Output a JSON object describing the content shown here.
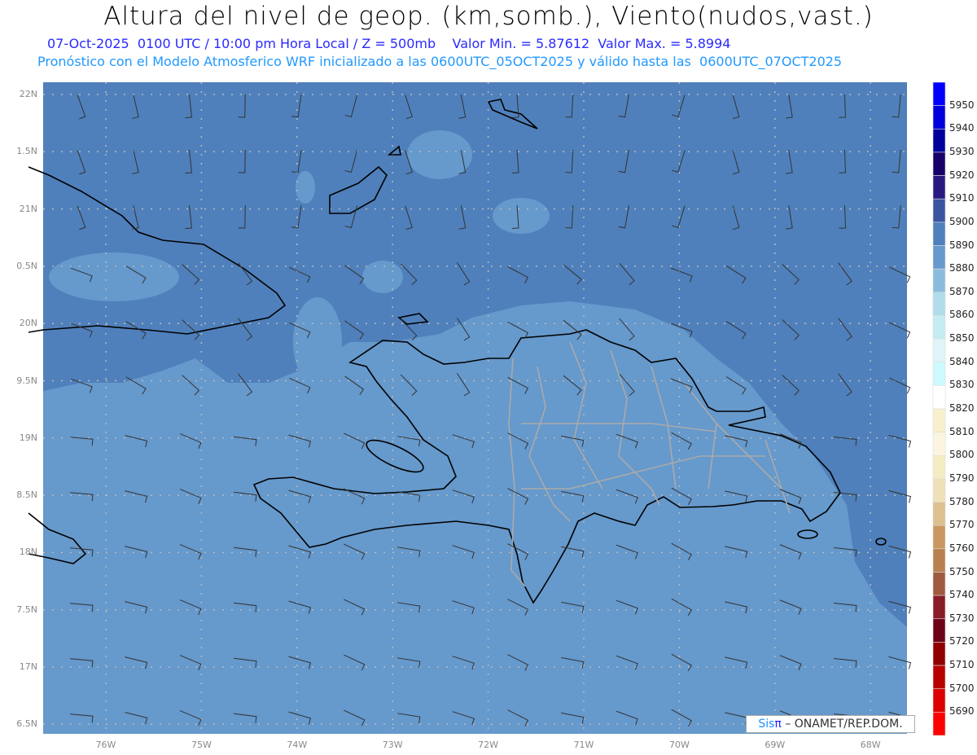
{
  "title": "Altura del nivel de geop. (km,somb.), Viento(nudos,vast.)",
  "subtitle1": "07-Oct-2025  0100 UTC / 10:00 pm Hora Local / Z = 500mb    Valor Min. = 5.87612  Valor Max. = 5.8994",
  "subtitle2": "Pronóstico con el Modelo Atmosferico WRF inicializado a las 0600UTC_05OCT2025 y válido hasta las  0600UTC_07OCT2025",
  "lat_labels": [
    "22N",
    "1.5N",
    "21N",
    "0.5N",
    "20N",
    "9.5N",
    "19N",
    "8.5N",
    "18N",
    "7.5N",
    "17N",
    "6.5N"
  ],
  "lon_labels": [
    "76W",
    "75W",
    "74W",
    "73W",
    "72W",
    "71W",
    "70W",
    "69W",
    "68W"
  ],
  "colorbar": {
    "labels": [
      "5950",
      "5940",
      "5930",
      "5920",
      "5910",
      "5900",
      "5890",
      "5880",
      "5870",
      "5860",
      "5850",
      "5840",
      "5830",
      "5820",
      "5810",
      "5800",
      "5790",
      "5780",
      "5770",
      "5760",
      "5750",
      "5740",
      "5730",
      "5720",
      "5710",
      "5700",
      "5690"
    ],
    "colors": [
      "#0000ff",
      "#0000dd",
      "#00009a",
      "#18006a",
      "#2a1a80",
      "#3a55a0",
      "#4f80bb",
      "#6699cc",
      "#8bbcdc",
      "#b0dde9",
      "#c4ecf2",
      "#dff5f8",
      "#ccfaff",
      "#ffffff",
      "#f8f0cc",
      "#fbf5e0",
      "#f6ecc4",
      "#efe0b8",
      "#dcc090",
      "#c89860",
      "#b98050",
      "#a05a40",
      "#881c28",
      "#6e0018",
      "#900000",
      "#b80000",
      "#dd0000",
      "#ff0000"
    ]
  },
  "colors": {
    "sea_high": "#4f80bb",
    "sea_low": "#6699cc",
    "coast": "#000000",
    "provinces": "#aaaaaa"
  },
  "logo": {
    "sis": "Sis",
    "pi": "π",
    "rest": "– ONAMET/REP.DOM."
  }
}
